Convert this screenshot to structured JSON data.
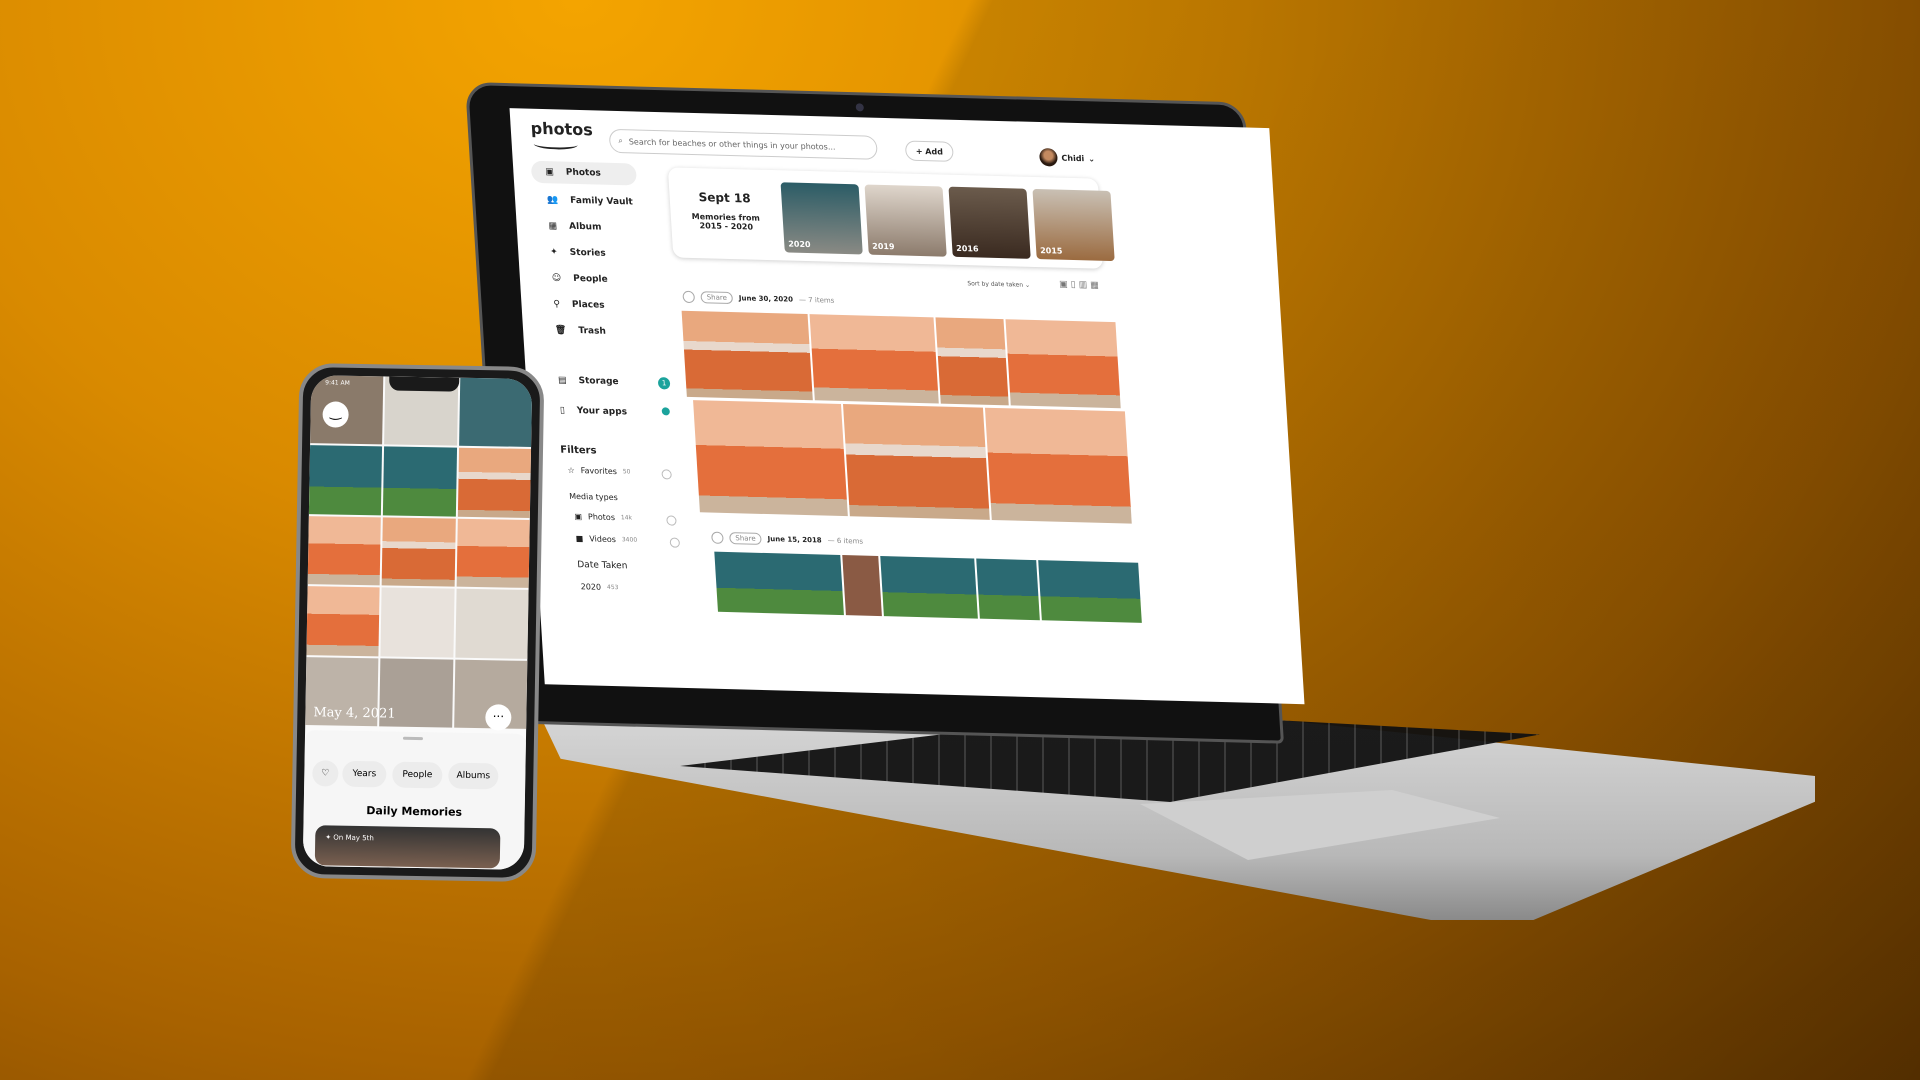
{
  "app": {
    "logo": "photos",
    "search_placeholder": "Search for beaches or other things in your photos...",
    "add_label": "+ Add",
    "user": "Chidi"
  },
  "sidebar": {
    "items": [
      {
        "label": "Photos",
        "icon": "photo-icon"
      },
      {
        "label": "Family Vault",
        "icon": "people-icon"
      },
      {
        "label": "Album",
        "icon": "album-icon"
      },
      {
        "label": "Stories",
        "icon": "sparkle-icon"
      },
      {
        "label": "People",
        "icon": "face-icon"
      },
      {
        "label": "Places",
        "icon": "pin-icon"
      },
      {
        "label": "Trash",
        "icon": "trash-icon"
      }
    ],
    "storage": {
      "label": "Storage",
      "badge": "1"
    },
    "apps": {
      "label": "Your apps"
    },
    "filters": {
      "title": "Filters",
      "favorites": {
        "label": "Favorites",
        "count": "50"
      },
      "media_types": "Media types",
      "photos": {
        "label": "Photos",
        "count": "14k"
      },
      "videos": {
        "label": "Videos",
        "count": "3400"
      },
      "date_taken": "Date Taken",
      "year": {
        "label": "2020",
        "count": "453"
      }
    }
  },
  "memories": {
    "date": "Sept 18",
    "subtitle1": "Memories from",
    "subtitle2": "2015 - 2020",
    "thumbs": [
      "2020",
      "2019",
      "2016",
      "2015"
    ]
  },
  "sort": {
    "label": "Sort by date taken"
  },
  "groups": [
    {
      "share": "Share",
      "date": "June 30, 2020",
      "count": "— 7 items"
    },
    {
      "share": "Share",
      "date": "June 15, 2018",
      "count": "— 6 items"
    }
  ],
  "phone": {
    "time": "9:41 AM",
    "date": "May 4, 2021",
    "chips": [
      "Years",
      "People",
      "Albums"
    ],
    "section": "Daily Memories",
    "card": "On May 5th"
  },
  "colors": {
    "accent": "#1ba39c",
    "background": "#e09000"
  }
}
